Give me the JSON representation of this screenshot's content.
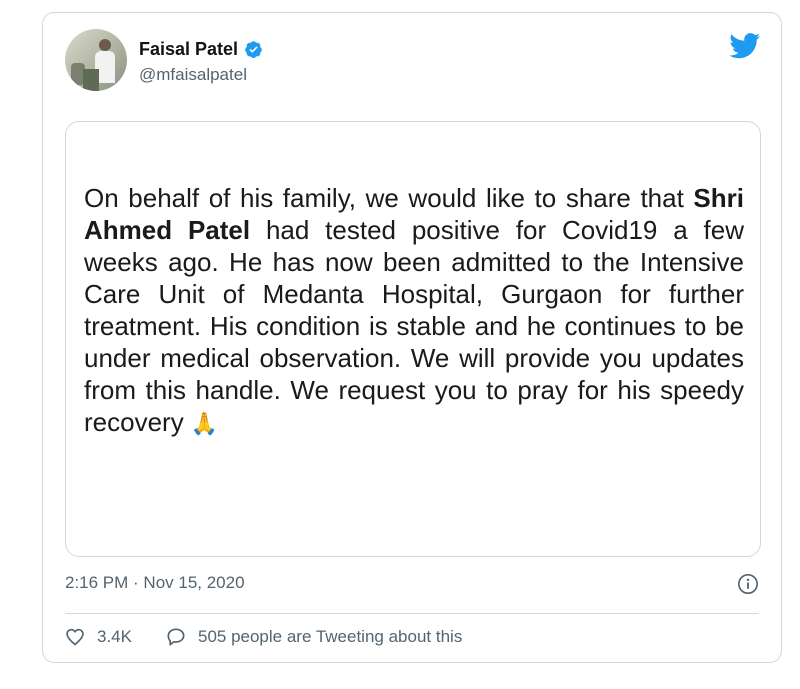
{
  "author": {
    "name": "Faisal Patel",
    "handle": "@mfaisalpatel"
  },
  "statement": {
    "part1": "On behalf of his family, we would like to share that ",
    "bold": "Shri Ahmed Patel",
    "part2": " had tested positive for Covid19 a few weeks ago. He has now been admitted to the Intensive Care Unit of Medanta Hospital, Gurgaon for further treatment. His condition is stable and he continues to be under medical observation. We will provide you updates from this handle. We request you to pray for his speedy recovery ",
    "emoji": "🙏"
  },
  "timestamp": "2:16 PM · Nov 15, 2020",
  "actions": {
    "likes": "3.4K",
    "tweeting": "505 people are Tweeting about this"
  },
  "colors": {
    "brand": "#1d9bf0",
    "secondary_text": "#536471",
    "border": "#cfd9de"
  },
  "icons": [
    "verified-badge-icon",
    "twitter-bird-icon",
    "info-icon",
    "heart-icon",
    "speech-bubble-icon"
  ]
}
